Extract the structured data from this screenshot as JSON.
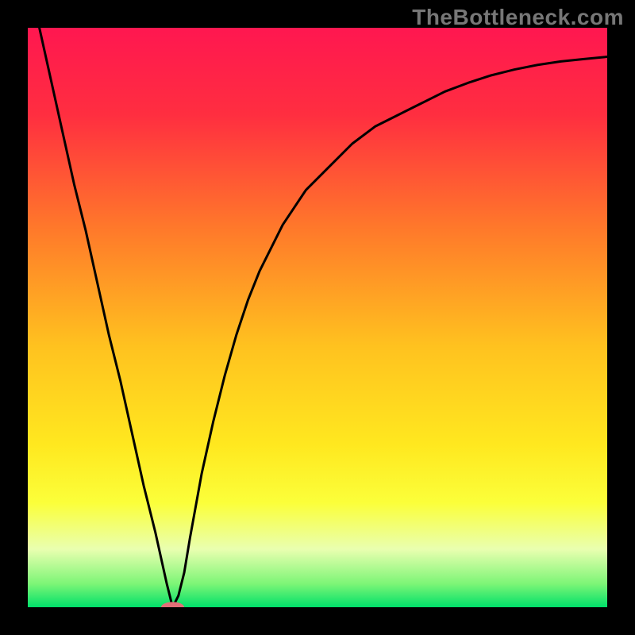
{
  "watermark": "TheBottleneck.com",
  "chart_data": {
    "type": "line",
    "title": "",
    "xlabel": "",
    "ylabel": "",
    "xlim": [
      0,
      100
    ],
    "ylim": [
      0,
      100
    ],
    "gradient_stops": [
      {
        "offset": 0.0,
        "color": "#ff1750"
      },
      {
        "offset": 0.15,
        "color": "#ff2e40"
      },
      {
        "offset": 0.35,
        "color": "#ff7a2a"
      },
      {
        "offset": 0.55,
        "color": "#ffc21f"
      },
      {
        "offset": 0.72,
        "color": "#ffe81f"
      },
      {
        "offset": 0.82,
        "color": "#fbff3a"
      },
      {
        "offset": 0.9,
        "color": "#e9ffb0"
      },
      {
        "offset": 0.96,
        "color": "#7cf576"
      },
      {
        "offset": 1.0,
        "color": "#00e06a"
      }
    ],
    "series": [
      {
        "name": "bottleneck-curve",
        "x": [
          2,
          4,
          6,
          8,
          10,
          12,
          14,
          16,
          18,
          20,
          22,
          24,
          25,
          26,
          27,
          28,
          30,
          32,
          34,
          36,
          38,
          40,
          44,
          48,
          52,
          56,
          60,
          64,
          68,
          72,
          76,
          80,
          84,
          88,
          92,
          96,
          100
        ],
        "y": [
          100,
          91,
          82,
          73,
          65,
          56,
          47,
          39,
          30,
          21,
          13,
          4,
          0,
          2,
          6,
          12,
          23,
          32,
          40,
          47,
          53,
          58,
          66,
          72,
          76,
          80,
          83,
          85,
          87,
          89,
          90.5,
          91.8,
          92.8,
          93.6,
          94.2,
          94.6,
          95
        ]
      }
    ],
    "marker": {
      "x": 25,
      "y": 0,
      "rx": 2.0,
      "ry": 0.9,
      "color": "#e26f77"
    }
  }
}
